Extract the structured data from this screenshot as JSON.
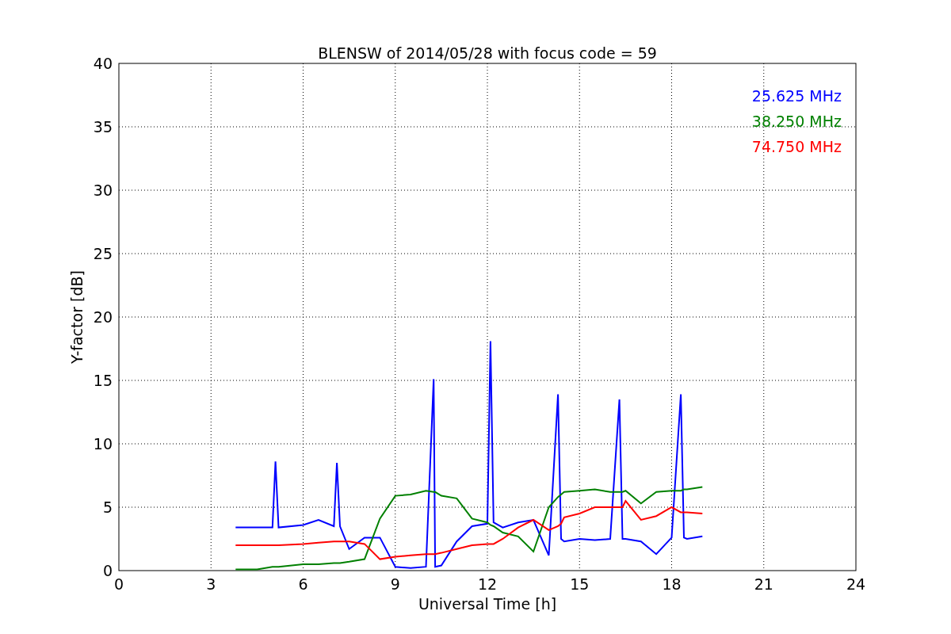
{
  "figure": {
    "chart_data": {
      "type": "line",
      "title": "BLENSW of 2014/05/28 with focus code = 59",
      "xlabel": "Universal Time [h]",
      "ylabel": "Y-factor [dB]",
      "x": [
        3.8,
        4.5,
        5,
        5.1,
        5.2,
        6,
        6.5,
        7,
        7.1,
        7.2,
        7.5,
        8,
        8.5,
        9,
        9.5,
        10,
        10.25,
        10.3,
        10.5,
        11,
        11.5,
        12,
        12.1,
        12.2,
        12.5,
        13,
        13.5,
        14,
        14.3,
        14.4,
        14.5,
        15,
        15.5,
        16,
        16.3,
        16.4,
        16.5,
        17,
        17.5,
        18,
        18.3,
        18.4,
        18.5,
        19
      ],
      "series": [
        {
          "name": "25.625 MHz",
          "color": "#0000ff",
          "values": [
            3.4,
            3.4,
            3.4,
            8.6,
            3.4,
            3.6,
            4,
            3.5,
            8.5,
            3.5,
            1.7,
            2.6,
            2.6,
            0.3,
            0.2,
            0.3,
            15.1,
            0.3,
            0.4,
            2.3,
            3.5,
            3.7,
            18.1,
            3.8,
            3.4,
            3.8,
            4,
            1.2,
            13.9,
            2.5,
            2.3,
            2.5,
            2.4,
            2.5,
            13.5,
            2.5,
            2.5,
            2.3,
            1.3,
            2.6,
            13.9,
            2.6,
            2.5,
            2.7
          ]
        },
        {
          "name": "38.250 MHz",
          "color": "#008000",
          "values": [
            0.1,
            0.1,
            0.3,
            0.3,
            0.3,
            0.5,
            0.5,
            0.6,
            0.6,
            0.6,
            0.7,
            0.9,
            4.1,
            5.9,
            6,
            6.3,
            6.2,
            6.2,
            5.9,
            5.7,
            4.1,
            3.8,
            3.6,
            3.5,
            3,
            2.7,
            1.5,
            5,
            5.8,
            6,
            6.2,
            6.3,
            6.4,
            6.2,
            6.2,
            6.2,
            6.3,
            5.3,
            6.2,
            6.3,
            6.3,
            6.4,
            6.4,
            6.6
          ]
        },
        {
          "name": "74.750 MHz",
          "color": "#ff0000",
          "values": [
            2,
            2,
            2,
            2,
            2,
            2.1,
            2.2,
            2.3,
            2.3,
            2.3,
            2.3,
            2.1,
            0.9,
            1.1,
            1.2,
            1.3,
            1.3,
            1.3,
            1.4,
            1.7,
            2,
            2.1,
            2.1,
            2.1,
            2.5,
            3.4,
            4,
            3.2,
            3.5,
            3.7,
            4.2,
            4.5,
            5,
            5,
            5,
            5,
            5.5,
            4,
            4.3,
            5,
            4.6,
            4.6,
            4.6,
            4.5
          ]
        }
      ],
      "grid": true,
      "xlim": [
        0,
        24
      ],
      "ylim": [
        0,
        40
      ],
      "xticks": [
        0,
        3,
        6,
        9,
        12,
        15,
        18,
        21,
        24
      ],
      "yticks": [
        0,
        5,
        10,
        15,
        20,
        25,
        30,
        35,
        40
      ]
    }
  }
}
